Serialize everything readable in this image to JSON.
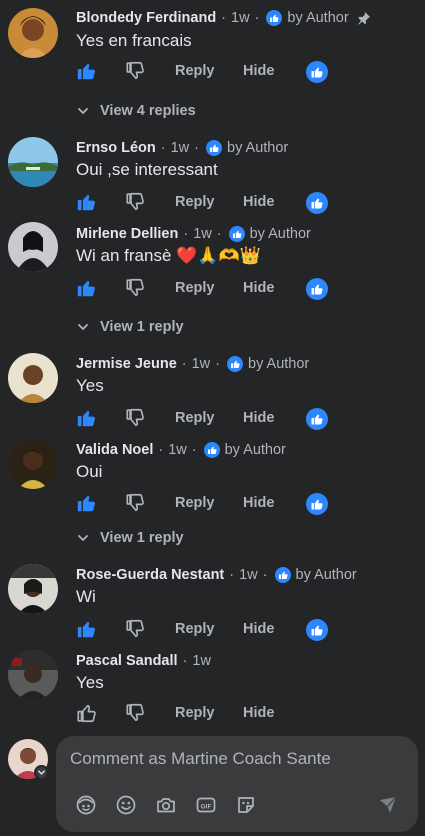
{
  "labels": {
    "reply": "Reply",
    "hide": "Hide",
    "by_author": "by Author",
    "dot": "·"
  },
  "comments": [
    {
      "name": "Blondedy Ferdinand",
      "time": "1w",
      "text": "Yes en francais",
      "pinned": true,
      "author_liked": true,
      "liked": true,
      "view_replies": "View 4 replies"
    },
    {
      "name": "Ernso Léon",
      "time": "1w",
      "text": "Oui ,se interessant",
      "pinned": false,
      "author_liked": true,
      "liked": true
    },
    {
      "name": "Mirlene Dellien",
      "time": "1w",
      "text": "Wi an fransè ❤️🙏🫶👑",
      "pinned": false,
      "author_liked": true,
      "liked": true,
      "view_replies": "View 1 reply"
    },
    {
      "name": "Jermise Jeune",
      "time": "1w",
      "text": "Yes",
      "pinned": false,
      "author_liked": true,
      "liked": true
    },
    {
      "name": "Valida Noel",
      "time": "1w",
      "text": "Oui",
      "pinned": false,
      "author_liked": true,
      "liked": true,
      "view_replies": "View 1 reply"
    },
    {
      "name": "Rose-Guerda Nestant",
      "time": "1w",
      "text": "Wi",
      "pinned": false,
      "author_liked": true,
      "liked": true
    },
    {
      "name": "Pascal Sandall",
      "time": "1w",
      "text": "Yes",
      "pinned": false,
      "author_liked": false,
      "liked": false
    }
  ],
  "composer": {
    "placeholder": "Comment as Martine Coach Sante"
  },
  "icons": {
    "like_active": "thumbs-up-icon",
    "like_inactive": "thumbs-up-outline-icon",
    "dislike": "thumbs-down-icon",
    "reaction": "like-reaction-badge-icon",
    "pin": "pin-icon",
    "chevron": "chevron-down-icon",
    "tools": [
      "avatar-sticker-icon",
      "emoji-icon",
      "camera-icon",
      "gif-icon",
      "sticker-icon"
    ],
    "send": "send-icon"
  },
  "colors": {
    "accent": "#2d88ff",
    "background": "#242526",
    "surface": "#3a3b3c",
    "primary_text": "#e4e6eb",
    "secondary_text": "#b0b3b8"
  }
}
